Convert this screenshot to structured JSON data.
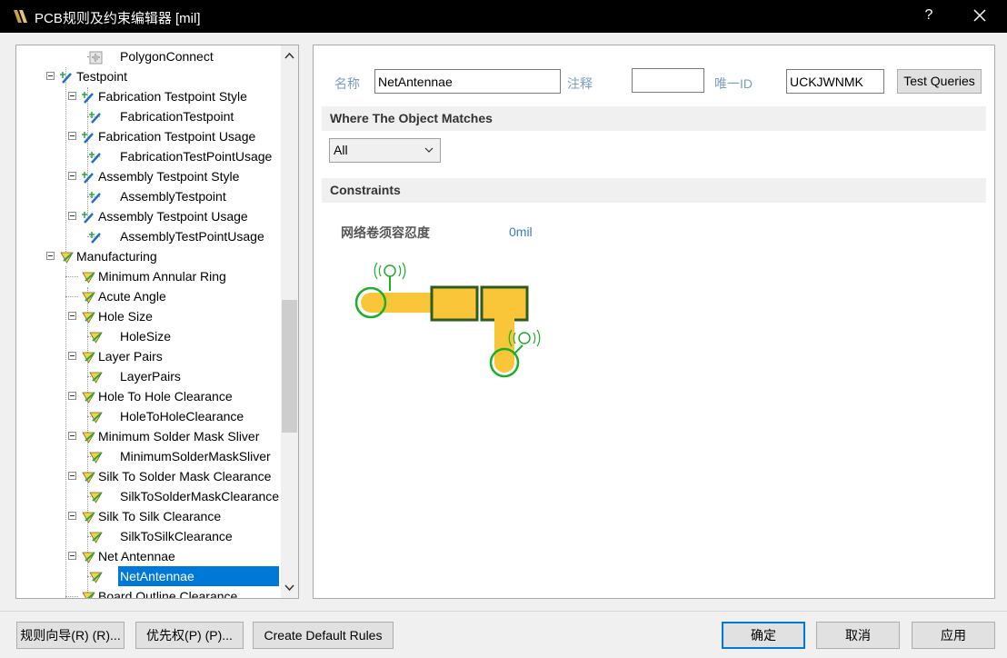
{
  "window": {
    "title": "PCB规则及约束编辑器 [mil]",
    "help": "?"
  },
  "tree": {
    "rows": [
      {
        "label": "PolygonConnect",
        "icon": "polygon-rule-icon"
      },
      {
        "label": "Testpoint",
        "icon": "testpoint-category-icon"
      },
      {
        "label": "Fabrication Testpoint Style",
        "icon": "testpoint-rule-icon"
      },
      {
        "label": "FabricationTestpoint",
        "icon": "testpoint-rule-icon"
      },
      {
        "label": "Fabrication Testpoint Usage",
        "icon": "testpoint-rule-icon"
      },
      {
        "label": "FabricationTestPointUsage",
        "icon": "testpoint-rule-icon"
      },
      {
        "label": "Assembly Testpoint Style",
        "icon": "testpoint-rule-icon"
      },
      {
        "label": "AssemblyTestpoint",
        "icon": "testpoint-rule-icon"
      },
      {
        "label": "Assembly Testpoint Usage",
        "icon": "testpoint-rule-icon"
      },
      {
        "label": "AssemblyTestPointUsage",
        "icon": "testpoint-rule-icon"
      },
      {
        "label": "Manufacturing",
        "icon": "manufacturing-category-icon"
      },
      {
        "label": "Minimum Annular Ring",
        "icon": "manufacturing-rule-icon"
      },
      {
        "label": "Acute Angle",
        "icon": "manufacturing-rule-icon"
      },
      {
        "label": "Hole Size",
        "icon": "manufacturing-rule-icon"
      },
      {
        "label": "HoleSize",
        "icon": "manufacturing-rule-icon"
      },
      {
        "label": "Layer Pairs",
        "icon": "manufacturing-rule-icon"
      },
      {
        "label": "LayerPairs",
        "icon": "manufacturing-rule-icon"
      },
      {
        "label": "Hole To Hole Clearance",
        "icon": "manufacturing-rule-icon"
      },
      {
        "label": "HoleToHoleClearance",
        "icon": "manufacturing-rule-icon"
      },
      {
        "label": "Minimum Solder Mask Sliver",
        "icon": "manufacturing-rule-icon"
      },
      {
        "label": "MinimumSolderMaskSliver",
        "icon": "manufacturing-rule-icon"
      },
      {
        "label": "Silk To Solder Mask Clearance",
        "icon": "manufacturing-rule-icon"
      },
      {
        "label": "SilkToSolderMaskClearance",
        "icon": "manufacturing-rule-icon"
      },
      {
        "label": "Silk To Silk Clearance",
        "icon": "manufacturing-rule-icon"
      },
      {
        "label": "SilkToSilkClearance",
        "icon": "manufacturing-rule-icon"
      },
      {
        "label": "Net Antennae",
        "icon": "manufacturing-rule-icon"
      },
      {
        "label": "NetAntennae",
        "icon": "manufacturing-rule-icon"
      },
      {
        "label": "Board Outline Clearance",
        "icon": "manufacturing-rule-icon"
      }
    ]
  },
  "rule": {
    "name_label": "名称",
    "name_value": "NetAntennae",
    "comment_label": "注释",
    "comment_value": "",
    "id_label": "唯一ID",
    "id_value": "UCKJWNMK",
    "test_queries": "Test Queries",
    "where_title": "Where The Object Matches",
    "where_value": "All",
    "constraints_title": "Constraints",
    "tolerance_label": "网络卷须容忍度",
    "tolerance_value": "0mil"
  },
  "buttons": {
    "wizard": "规则向导(R) (R)...",
    "priority": "优先权(P) (P)...",
    "create_default": "Create Default Rules",
    "ok": "确定",
    "cancel": "取消",
    "apply": "应用"
  },
  "colors": {
    "selection": "#0078d7",
    "label_blue": "#7a9cc6",
    "pad_yellow": "#f9c63a",
    "antenna_green": "#1aae2a",
    "pad_outline": "#2f5c1e"
  }
}
